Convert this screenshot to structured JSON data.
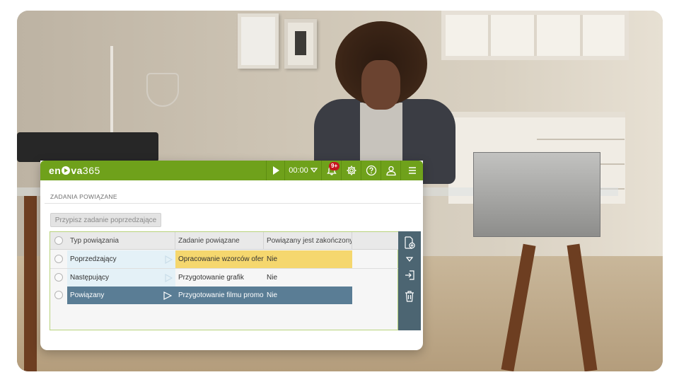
{
  "app": {
    "logo_text": "en",
    "logo_text2": "va",
    "logo_version": "365",
    "timer": "00:00",
    "notification_badge": "9+"
  },
  "section": {
    "title": "ZADANIA POWIĄZANE",
    "assign_button": "Przypisz zadanie poprzedzające"
  },
  "grid": {
    "columns": [
      "Typ powiązania",
      "Zadanie powiązane",
      "Powiązany jest zakończony?"
    ],
    "rows": [
      {
        "type": "Poprzedzający",
        "task": "Opracowanie wzorców oferto",
        "done": "Nie",
        "state": "highlight-yellow"
      },
      {
        "type": "Następujący",
        "task": "Przygotowanie grafik",
        "done": "Nie",
        "state": "normal"
      },
      {
        "type": "Powiązany",
        "task": "Przygotowanie filmu promocy",
        "done": "Nie",
        "state": "selected"
      }
    ]
  },
  "colors": {
    "brand_green": "#6fa11b",
    "selected_row": "#5a7d95",
    "highlight_yellow": "#f5d76e",
    "side_toolbar": "#4c6572",
    "badge_red": "#c6161f"
  },
  "icons": [
    "play-icon",
    "chevron-down-icon",
    "bell-icon",
    "gear-icon",
    "help-icon",
    "user-icon",
    "menu-icon",
    "add-document-icon",
    "chevron-down-icon",
    "login-icon",
    "trash-icon"
  ]
}
